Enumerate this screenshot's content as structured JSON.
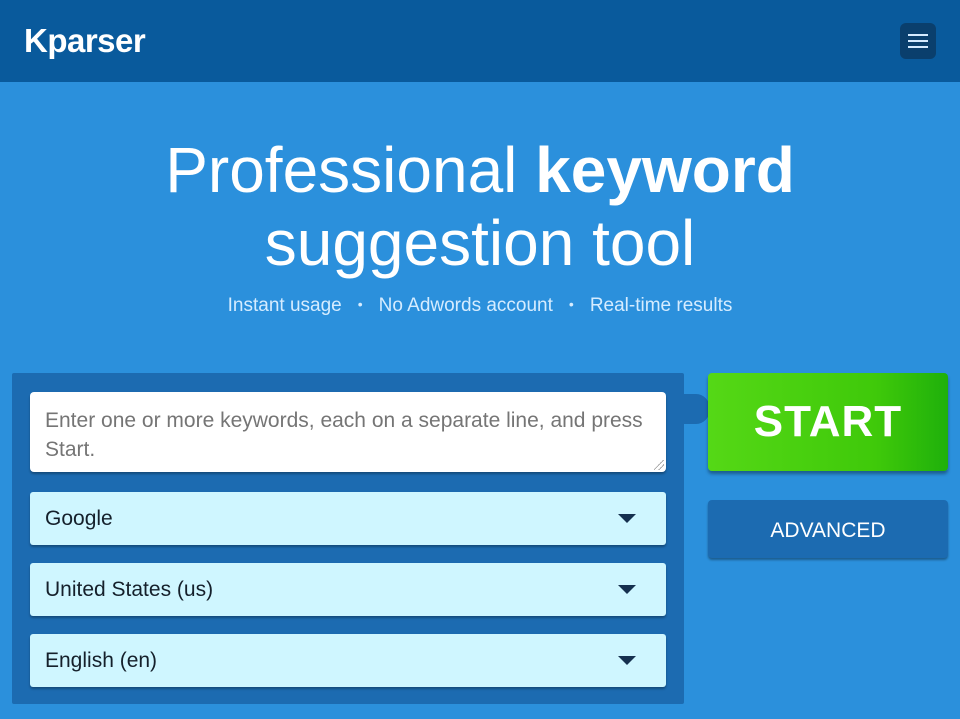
{
  "header": {
    "logo": "Kparser",
    "menu_icon": "hamburger-menu-icon"
  },
  "hero": {
    "line1_regular": "Professional ",
    "line1_bold": "keyword",
    "line2": "suggestion tool"
  },
  "features": [
    "Instant usage",
    "No Adwords account",
    "Real-time results"
  ],
  "separator": "•",
  "form": {
    "keywords_placeholder": "Enter one or more keywords, each on a separate line, and press Start.",
    "source": "Google",
    "country": "United States (us)",
    "language": "English (en)"
  },
  "buttons": {
    "start": "START",
    "advanced": "ADVANCED"
  },
  "colors": {
    "background": "#2b90dc",
    "header": "#095a9c",
    "panel": "#1c6bb1",
    "start": "#3fc90a",
    "select_bg": "#cff6ff"
  }
}
